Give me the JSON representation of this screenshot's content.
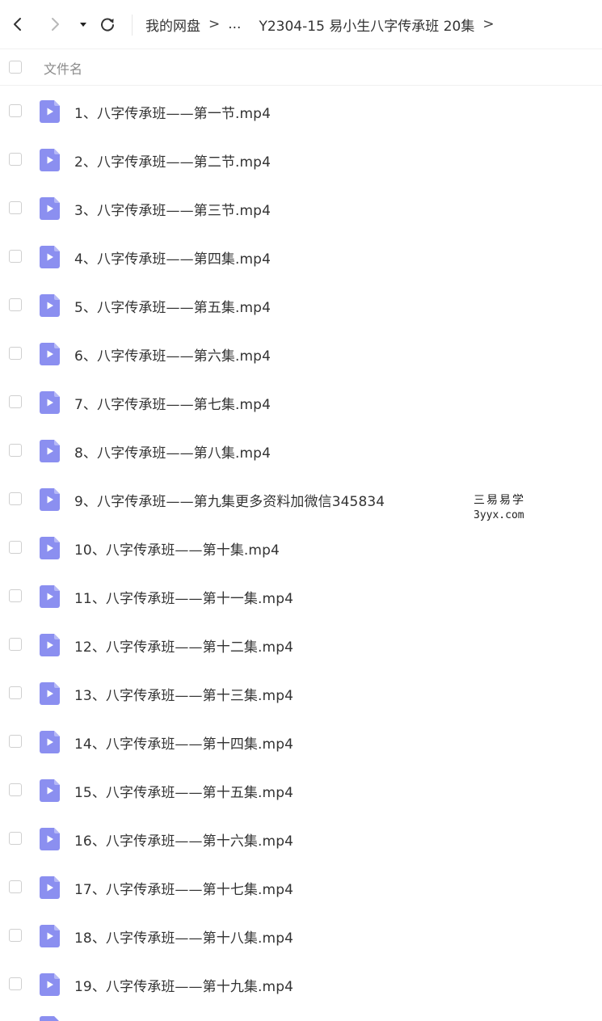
{
  "toolbar": {
    "back_icon": "chevron-left-icon",
    "forward_icon": "chevron-right-icon",
    "dropdown_icon": "caret-down-icon",
    "refresh_icon": "refresh-icon"
  },
  "breadcrumb": {
    "root": "我的网盘",
    "ellipsis": "...",
    "current": "Y2304-15 易小生八字传承班 20集",
    "separator": ">"
  },
  "list_header": {
    "column_filename": "文件名"
  },
  "files": [
    {
      "name": "1、八字传承班——第一节.mp4"
    },
    {
      "name": "2、八字传承班——第二节.mp4"
    },
    {
      "name": "3、八字传承班——第三节.mp4"
    },
    {
      "name": "4、八字传承班——第四集.mp4"
    },
    {
      "name": "5、八字传承班——第五集.mp4"
    },
    {
      "name": "6、八字传承班——第六集.mp4"
    },
    {
      "name": "7、八字传承班——第七集.mp4"
    },
    {
      "name": "8、八字传承班——第八集.mp4"
    },
    {
      "name": "9、八字传承班——第九集更多资料加微信345834"
    },
    {
      "name": "10、八字传承班——第十集.mp4"
    },
    {
      "name": "11、八字传承班——第十一集.mp4"
    },
    {
      "name": "12、八字传承班——第十二集.mp4"
    },
    {
      "name": "13、八字传承班——第十三集.mp4"
    },
    {
      "name": "14、八字传承班——第十四集.mp4"
    },
    {
      "name": "15、八字传承班——第十五集.mp4"
    },
    {
      "name": "16、八字传承班——第十六集.mp4"
    },
    {
      "name": "17、八字传承班——第十七集.mp4"
    },
    {
      "name": "18、八字传承班——第十八集.mp4"
    },
    {
      "name": "19、八字传承班——第十九集.mp4"
    }
  ],
  "file_icon": "video-file-icon",
  "colors": {
    "icon_fill": "#8b8ff0",
    "icon_fold": "#b5b8f6",
    "checkbox_border": "#cfcfcf",
    "header_text": "#8a8a8a"
  },
  "watermark": {
    "line1": "三易易学",
    "line2": "3yyx.com"
  }
}
